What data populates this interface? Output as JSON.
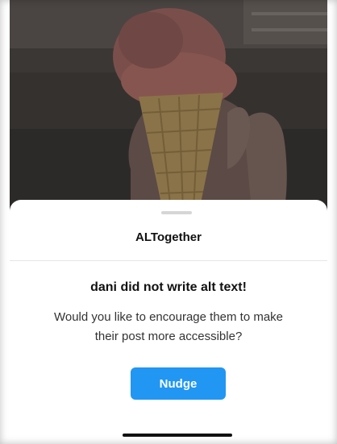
{
  "background_photo": {
    "description_icon": "ice-cream-cone-photo"
  },
  "sheet": {
    "title": "ALTogether",
    "heading": "dani did not write alt text!",
    "body": "Would you like to encourage them to make their post more accessible?",
    "button_label": "Nudge"
  },
  "colors": {
    "accent": "#2196f3",
    "sheet_background": "#ffffff",
    "divider": "#e6e6e6",
    "title_text": "#111111",
    "body_text": "#333333"
  }
}
